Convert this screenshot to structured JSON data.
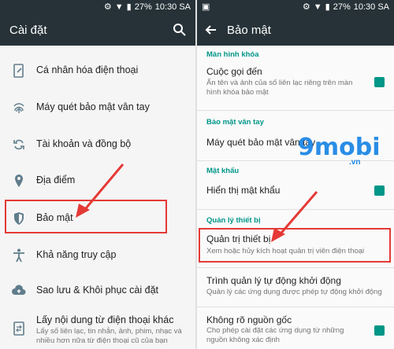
{
  "status": {
    "battery": "27%",
    "time": "10:30 SA"
  },
  "left": {
    "title": "Cài đặt",
    "items": [
      {
        "label": "Cá nhân hóa điện thoại",
        "icon": "phone-edit-icon"
      },
      {
        "label": "Máy quét bảo mật vân tay",
        "icon": "fingerprint-icon"
      },
      {
        "label": "Tài khoản và đồng bộ",
        "icon": "sync-icon"
      },
      {
        "label": "Địa điểm",
        "icon": "location-icon"
      },
      {
        "label": "Bảo mật",
        "icon": "shield-icon"
      },
      {
        "label": "Khả năng truy cập",
        "icon": "accessibility-icon"
      },
      {
        "label": "Sao lưu & Khôi phục cài đặt",
        "icon": "cloud-upload-icon"
      },
      {
        "label": "Lấy nội dung từ điện thoại khác",
        "sub": "Lấy số liên lạc, tin nhắn, ảnh, phim, nhạc và nhiều hơn nữa từ điện thoại cũ của bạn",
        "icon": "transfer-icon"
      }
    ]
  },
  "right": {
    "title": "Bảo mật",
    "watermark": "9mobi",
    "watermark_suffix": ".vn",
    "sections": {
      "lock_screen": "Màn hình khóa",
      "fingerprint": "Bảo mật vân tay",
      "password": "Mật khẩu",
      "device_admin": "Quản lý thiết bị"
    },
    "rows": {
      "calls": {
        "label": "Cuộc gọi đến",
        "sub": "Ẩn tên và ảnh của số liên lạc riêng trên màn hình khóa bảo mật"
      },
      "scanner": {
        "label": "Máy quét bảo mật vân tay"
      },
      "show_password": {
        "label": "Hiển thị mật khẩu"
      },
      "device_admin": {
        "label": "Quản trị thiết bị",
        "sub": "Xem hoặc hủy kích hoạt quản trị viên điện thoại"
      },
      "autostart": {
        "label": "Trình quản lý tự động khởi động",
        "sub": "Quản lý các ứng dụng được phép tự động khởi động"
      },
      "unknown_sources": {
        "label": "Không rõ nguồn gốc",
        "sub": "Cho phép cài đặt các ứng dụng từ những nguồn không xác định"
      }
    }
  },
  "colors": {
    "accent": "#009688",
    "toolbar": "#263238",
    "highlight": "#e53935"
  }
}
